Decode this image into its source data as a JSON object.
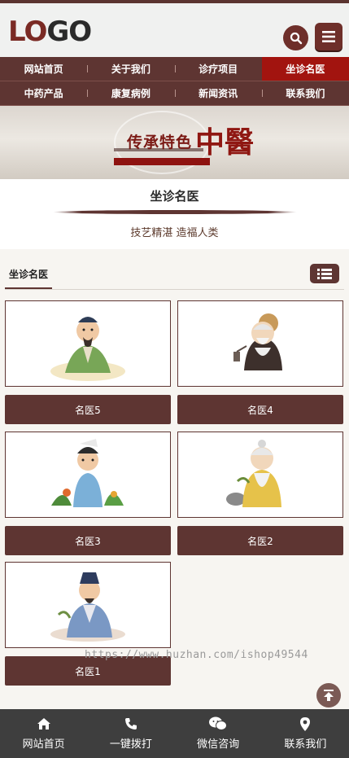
{
  "header": {
    "logo_text_a": "LO",
    "logo_text_b": "GO",
    "search_icon": "search-icon",
    "menu_icon": "hamburger-icon"
  },
  "nav": {
    "row1": [
      "网站首页",
      "关于我们",
      "诊疗项目",
      "坐诊名医"
    ],
    "row2": [
      "中药产品",
      "康复病例",
      "新闻资讯",
      "联系我们"
    ],
    "active": "坐诊名医"
  },
  "banner": {
    "title": "传承特色",
    "big_char": "中醫"
  },
  "section": {
    "title": "坐诊名医",
    "subtitle": "技艺精湛 造福人类"
  },
  "tabs": {
    "active_label": "坐诊名医",
    "list_icon": "list-icon"
  },
  "doctors": [
    {
      "name": "名医5"
    },
    {
      "name": "名医4"
    },
    {
      "name": "名医3"
    },
    {
      "name": "名医2"
    },
    {
      "name": "名医1"
    }
  ],
  "watermark": "https://www.huzhan.com/ishop49544",
  "bottom_bar": [
    {
      "label": "网站首页",
      "icon": "home-icon"
    },
    {
      "label": "一键拨打",
      "icon": "phone-icon"
    },
    {
      "label": "微信咨询",
      "icon": "wechat-icon"
    },
    {
      "label": "联系我们",
      "icon": "location-icon"
    }
  ],
  "colors": {
    "primary": "#5e3532",
    "active_nav": "#a2140f",
    "accent": "#6e2f2a"
  }
}
